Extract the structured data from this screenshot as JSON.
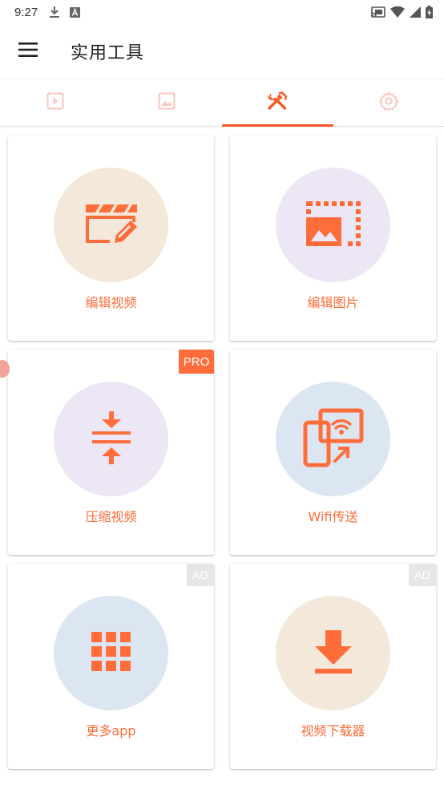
{
  "status_bar": {
    "time": "9:27",
    "icons": [
      "download-icon",
      "a-icon",
      "cast-icon",
      "wifi-icon",
      "signal-icon",
      "battery-icon"
    ]
  },
  "app_bar": {
    "title": "实用工具",
    "menu_icon": "hamburger-menu-icon"
  },
  "tabs": [
    {
      "name": "video",
      "icon": "play-square-icon",
      "active": false
    },
    {
      "name": "image",
      "icon": "image-icon",
      "active": false
    },
    {
      "name": "tools",
      "icon": "tools-icon",
      "active": true
    },
    {
      "name": "settings",
      "icon": "gear-icon",
      "active": false
    }
  ],
  "colors": {
    "accent": "#ff6d3a",
    "tab_active": "#ff5722",
    "tab_inactive": "#f7c8bd",
    "circle_beige": "#f3e8d9",
    "circle_lavender": "#ede6f4",
    "circle_blue": "#dce6f3"
  },
  "cards": [
    {
      "label": "编辑视频",
      "icon": "clapperboard-edit-icon",
      "badge": ""
    },
    {
      "label": "编辑图片",
      "icon": "image-crop-icon",
      "badge": ""
    },
    {
      "label": "压缩视频",
      "icon": "compress-icon",
      "badge": "PRO"
    },
    {
      "label": "Wifi传送",
      "icon": "wifi-transfer-icon",
      "badge": ""
    },
    {
      "label": "更多app",
      "icon": "apps-grid-icon",
      "badge": "AD"
    },
    {
      "label": "视频下载器",
      "icon": "download-icon",
      "badge": "AD"
    }
  ]
}
